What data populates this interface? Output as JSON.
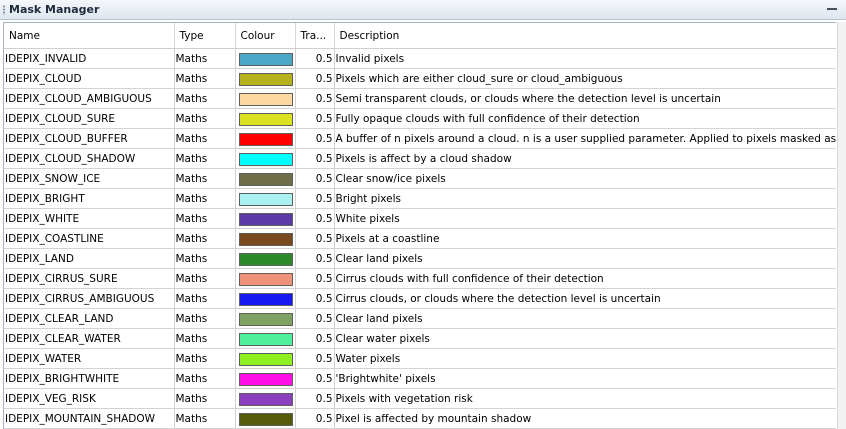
{
  "window": {
    "title": "Mask Manager"
  },
  "columns": [
    "Name",
    "Type",
    "Colour",
    "Tra...",
    "Description"
  ],
  "rows": [
    {
      "name": "IDEPIX_INVALID",
      "type": "Maths",
      "colour": "#4aa7c5",
      "transparency": "0.5",
      "description": "Invalid pixels"
    },
    {
      "name": "IDEPIX_CLOUD",
      "type": "Maths",
      "colour": "#b4b11a",
      "transparency": "0.5",
      "description": "Pixels which are either cloud_sure or cloud_ambiguous"
    },
    {
      "name": "IDEPIX_CLOUD_AMBIGUOUS",
      "type": "Maths",
      "colour": "#fcd9a0",
      "transparency": "0.5",
      "description": "Semi transparent clouds, or clouds where the detection level is uncertain"
    },
    {
      "name": "IDEPIX_CLOUD_SURE",
      "type": "Maths",
      "colour": "#dbe01f",
      "transparency": "0.5",
      "description": "Fully opaque clouds with full confidence of their detection"
    },
    {
      "name": "IDEPIX_CLOUD_BUFFER",
      "type": "Maths",
      "colour": "#ff0000",
      "transparency": "0.5",
      "description": "A buffer of n pixels around a cloud. n is a user supplied parameter. Applied to pixels masked as 'cloud'"
    },
    {
      "name": "IDEPIX_CLOUD_SHADOW",
      "type": "Maths",
      "colour": "#00ffff",
      "transparency": "0.5",
      "description": "Pixels is affect by a cloud shadow"
    },
    {
      "name": "IDEPIX_SNOW_ICE",
      "type": "Maths",
      "colour": "#6e6e4b",
      "transparency": "0.5",
      "description": "Clear snow/ice pixels"
    },
    {
      "name": "IDEPIX_BRIGHT",
      "type": "Maths",
      "colour": "#a9f0f0",
      "transparency": "0.5",
      "description": "Bright pixels"
    },
    {
      "name": "IDEPIX_WHITE",
      "type": "Maths",
      "colour": "#5b3ca6",
      "transparency": "0.5",
      "description": "White pixels"
    },
    {
      "name": "IDEPIX_COASTLINE",
      "type": "Maths",
      "colour": "#7a4a1f",
      "transparency": "0.5",
      "description": "Pixels at a coastline"
    },
    {
      "name": "IDEPIX_LAND",
      "type": "Maths",
      "colour": "#2d8a2a",
      "transparency": "0.5",
      "description": "Clear land pixels"
    },
    {
      "name": "IDEPIX_CIRRUS_SURE",
      "type": "Maths",
      "colour": "#f0927a",
      "transparency": "0.5",
      "description": "Cirrus clouds with full confidence of their detection"
    },
    {
      "name": "IDEPIX_CIRRUS_AMBIGUOUS",
      "type": "Maths",
      "colour": "#1818f0",
      "transparency": "0.5",
      "description": "Cirrus clouds, or clouds where the detection level is uncertain"
    },
    {
      "name": "IDEPIX_CLEAR_LAND",
      "type": "Maths",
      "colour": "#7da262",
      "transparency": "0.5",
      "description": "Clear land pixels"
    },
    {
      "name": "IDEPIX_CLEAR_WATER",
      "type": "Maths",
      "colour": "#4ef09c",
      "transparency": "0.5",
      "description": "Clear water pixels"
    },
    {
      "name": "IDEPIX_WATER",
      "type": "Maths",
      "colour": "#8ef021",
      "transparency": "0.5",
      "description": "Water pixels"
    },
    {
      "name": "IDEPIX_BRIGHTWHITE",
      "type": "Maths",
      "colour": "#ff0fe6",
      "transparency": "0.5",
      "description": "'Brightwhite' pixels"
    },
    {
      "name": "IDEPIX_VEG_RISK",
      "type": "Maths",
      "colour": "#8a3fbd",
      "transparency": "0.5",
      "description": "Pixels with vegetation risk"
    },
    {
      "name": "IDEPIX_MOUNTAIN_SHADOW",
      "type": "Maths",
      "colour": "#545c0a",
      "transparency": "0.5",
      "description": "Pixel is affected by mountain shadow"
    }
  ]
}
